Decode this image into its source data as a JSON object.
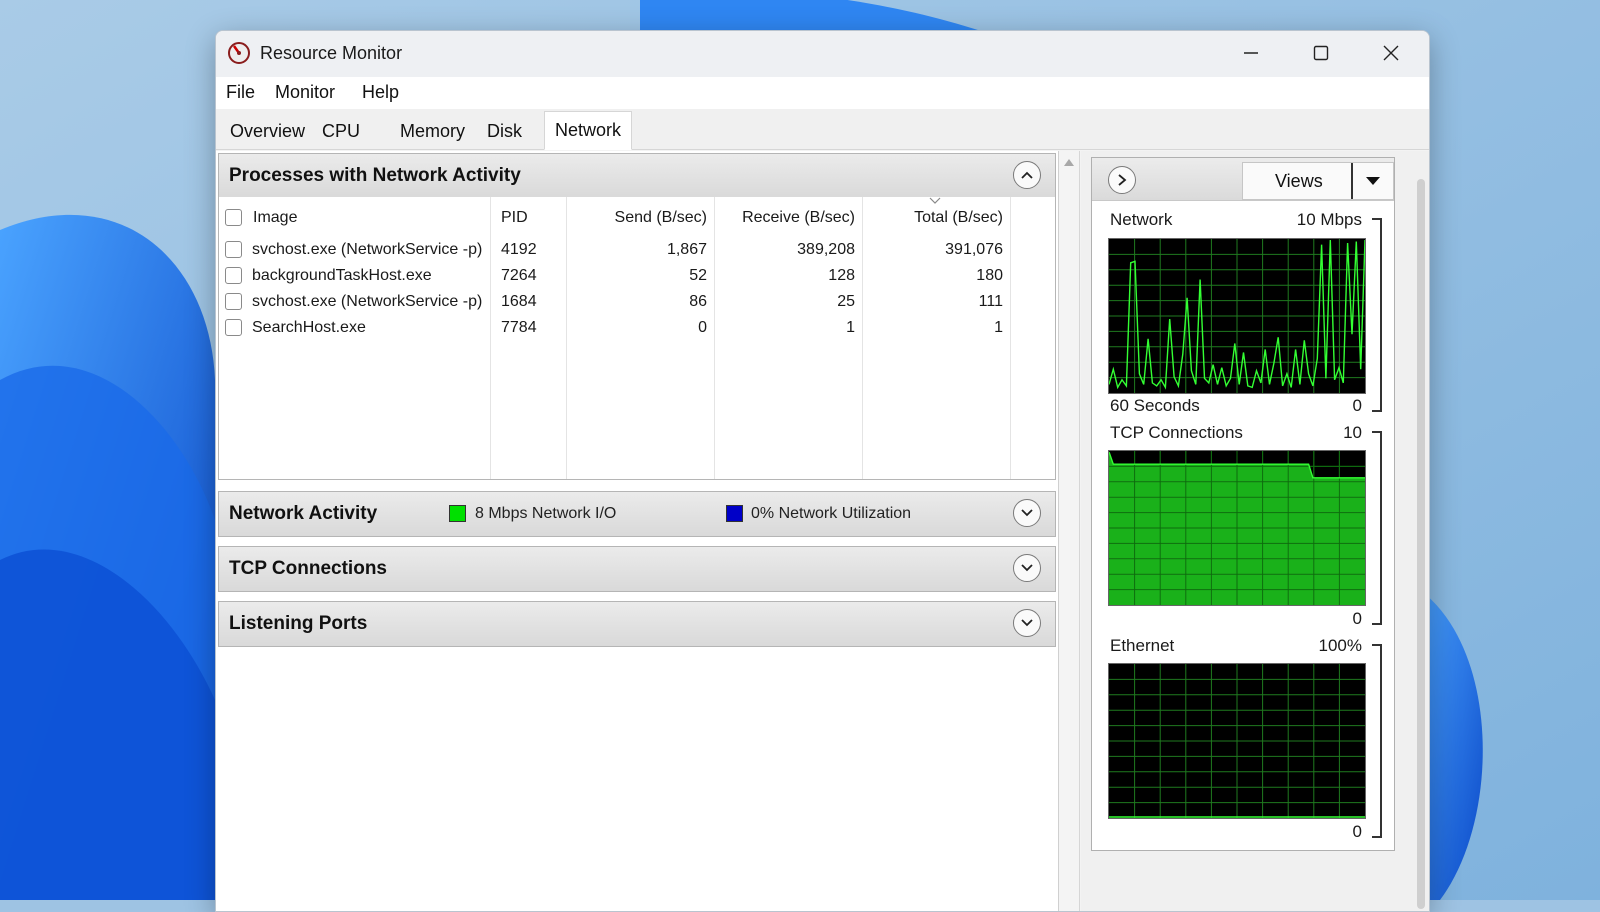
{
  "window": {
    "title": "Resource Monitor"
  },
  "menu": [
    "File",
    "Monitor",
    "Help"
  ],
  "tabs": [
    {
      "label": "Overview",
      "active": false
    },
    {
      "label": "CPU",
      "active": false
    },
    {
      "label": "Memory",
      "active": false
    },
    {
      "label": "Disk",
      "active": false
    },
    {
      "label": "Network",
      "active": true
    }
  ],
  "processes": {
    "title": "Processes with Network Activity",
    "columns": [
      "Image",
      "PID",
      "Send (B/sec)",
      "Receive (B/sec)",
      "Total (B/sec)"
    ],
    "rows": [
      {
        "image": "svchost.exe (NetworkService -p)",
        "pid": "4192",
        "send": "1,867",
        "receive": "389,208",
        "total": "391,076"
      },
      {
        "image": "backgroundTaskHost.exe",
        "pid": "7264",
        "send": "52",
        "receive": "128",
        "total": "180"
      },
      {
        "image": "svchost.exe (NetworkService -p)",
        "pid": "1684",
        "send": "86",
        "receive": "25",
        "total": "111"
      },
      {
        "image": "SearchHost.exe",
        "pid": "7784",
        "send": "0",
        "receive": "1",
        "total": "1"
      }
    ]
  },
  "network_activity": {
    "title": "Network Activity",
    "io_label": "8 Mbps Network I/O",
    "io_color": "#00e000",
    "util_label": "0% Network Utilization",
    "util_color": "#0000c8"
  },
  "tcp_connections": {
    "title": "TCP Connections"
  },
  "listening_ports": {
    "title": "Listening Ports"
  },
  "graphs": {
    "views_label": "Views",
    "network": {
      "title": "Network",
      "max": "10 Mbps",
      "footer_left": "60 Seconds",
      "footer_right": "0"
    },
    "tcp": {
      "title": "TCP Connections",
      "max": "10",
      "footer_right": "0"
    },
    "ethernet": {
      "title": "Ethernet",
      "max": "100%",
      "footer_right": "0"
    }
  },
  "chart_data": [
    {
      "type": "line",
      "title": "Network",
      "ylim": [
        0,
        10
      ],
      "xlabel": "60 Seconds",
      "series": [
        {
          "values": [
            0.5,
            1.5,
            0.3,
            0.8,
            0.4,
            8.5,
            8.6,
            1.2,
            0.5,
            3.5,
            0.6,
            0.4,
            0.8,
            0.3,
            4.8,
            1.0,
            0.4,
            2.5,
            6.2,
            1.4,
            0.5,
            7.4,
            0.9,
            0.6,
            1.8,
            0.5,
            1.6,
            0.4,
            0.9,
            3.2,
            0.5,
            2.6,
            0.4,
            0.3,
            1.4,
            0.6,
            2.8,
            0.5,
            1.9,
            3.6,
            0.4,
            1.2,
            0.3,
            2.8,
            0.5,
            3.4,
            1.2,
            0.4,
            2.2,
            9.7,
            0.9,
            10.0,
            0.8,
            1.6,
            0.6,
            9.8,
            3.8,
            9.9,
            1.5,
            10.0
          ]
        }
      ]
    },
    {
      "type": "area",
      "title": "TCP Connections",
      "ylim": [
        0,
        10
      ],
      "series": [
        {
          "values": [
            10,
            9.2,
            9.2,
            9.2,
            9.2,
            9.2,
            9.2,
            9.2,
            9.2,
            9.2,
            9.2,
            9.2,
            9.2,
            9.2,
            9.2,
            9.2,
            9.2,
            9.2,
            9.2,
            9.2,
            9.2,
            9.2,
            9.2,
            9.2,
            9.2,
            9.2,
            9.2,
            9.2,
            9.2,
            9.2,
            9.2,
            9.2,
            9.2,
            9.2,
            9.2,
            9.2,
            9.2,
            9.2,
            9.2,
            9.2,
            9.2,
            9.2,
            9.2,
            9.2,
            9.2,
            9.2,
            9.2,
            8.3,
            8.3,
            8.3,
            8.3,
            8.3,
            8.3,
            8.3,
            8.3,
            8.3,
            8.3,
            8.3,
            8.3,
            8.3
          ]
        }
      ]
    },
    {
      "type": "line",
      "title": "Ethernet",
      "ylim": [
        0,
        100
      ],
      "series": [
        {
          "values": [
            0,
            0,
            0,
            0,
            0,
            0,
            0,
            0,
            0,
            0,
            0,
            0,
            0,
            0,
            0,
            0,
            0,
            0,
            0,
            0,
            0,
            0,
            0,
            0,
            0,
            0,
            0,
            0,
            0,
            0,
            0,
            0,
            0,
            0,
            0,
            0,
            0,
            0,
            0,
            0,
            0,
            0,
            0,
            0,
            0,
            0,
            0,
            0,
            0,
            0,
            0,
            0,
            0,
            0,
            0,
            0,
            0,
            0,
            0,
            0
          ]
        }
      ]
    }
  ]
}
